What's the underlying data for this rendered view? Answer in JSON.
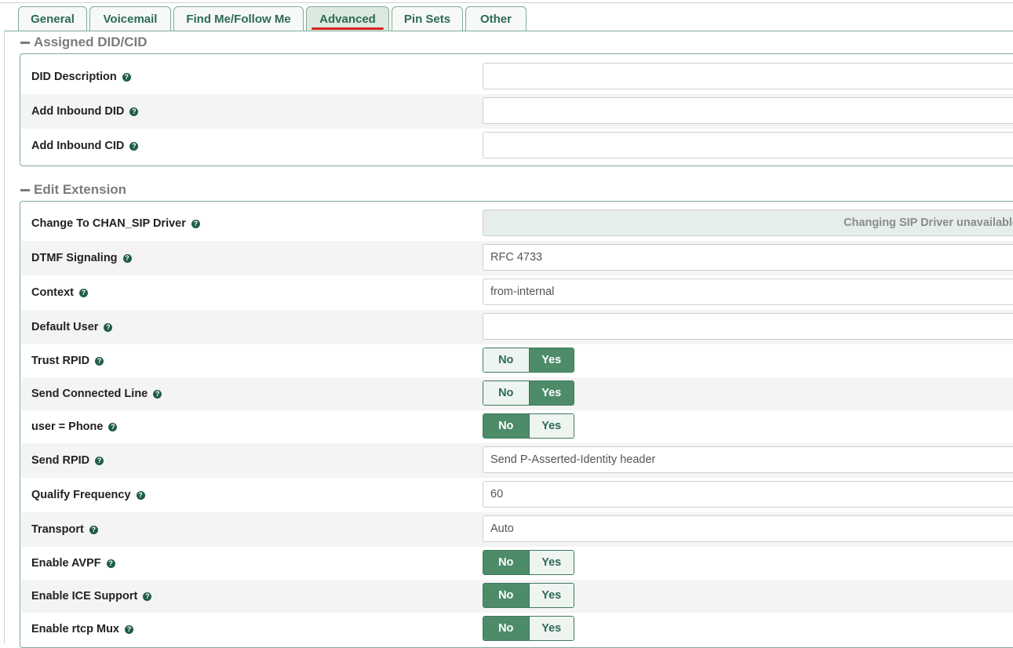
{
  "tabs": [
    {
      "label": "General"
    },
    {
      "label": "Voicemail"
    },
    {
      "label": "Find Me/Follow Me"
    },
    {
      "label": "Advanced"
    },
    {
      "label": "Pin Sets"
    },
    {
      "label": "Other"
    }
  ],
  "active_tab": "Advanced",
  "colors": {
    "accent": "#4d8b69",
    "tab_text": "#2d6a53",
    "active_underline": "#d9231d"
  },
  "sections": {
    "assigned": {
      "title": "Assigned DID/CID",
      "rows": [
        {
          "label": "DID Description",
          "value": ""
        },
        {
          "label": "Add Inbound DID",
          "value": ""
        },
        {
          "label": "Add Inbound CID",
          "value": ""
        }
      ]
    },
    "edit": {
      "title": "Edit Extension",
      "rows": [
        {
          "label": "Change To CHAN_SIP Driver",
          "value": "Changing SIP Driver unavailable"
        },
        {
          "label": "DTMF Signaling",
          "value": "RFC 4733"
        },
        {
          "label": "Context",
          "value": "from-internal"
        },
        {
          "label": "Default User",
          "value": ""
        },
        {
          "label": "Trust RPID",
          "no": "No",
          "yes": "Yes",
          "selected": "Yes"
        },
        {
          "label": "Send Connected Line",
          "no": "No",
          "yes": "Yes",
          "selected": "Yes"
        },
        {
          "label": "user = Phone",
          "no": "No",
          "yes": "Yes",
          "selected": "No"
        },
        {
          "label": "Send RPID",
          "value": "Send P-Asserted-Identity header"
        },
        {
          "label": "Qualify Frequency",
          "value": "60"
        },
        {
          "label": "Transport",
          "value": "Auto"
        },
        {
          "label": "Enable AVPF",
          "no": "No",
          "yes": "Yes",
          "selected": "No"
        },
        {
          "label": "Enable ICE Support",
          "no": "No",
          "yes": "Yes",
          "selected": "No"
        },
        {
          "label": "Enable rtcp Mux",
          "no": "No",
          "yes": "Yes",
          "selected": "No"
        }
      ]
    }
  }
}
